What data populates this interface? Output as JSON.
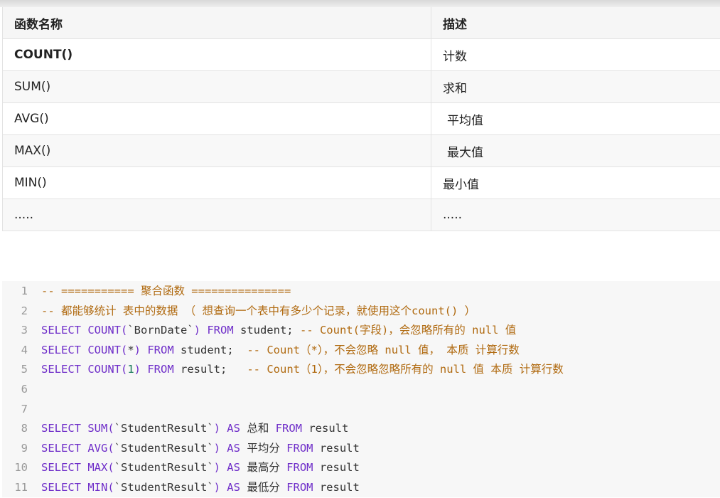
{
  "table": {
    "header": {
      "col1": "函数名称",
      "col2": "描述"
    },
    "rows": [
      {
        "name": "COUNT()",
        "desc": "计数"
      },
      {
        "name": "SUM()",
        "desc": "求和"
      },
      {
        "name": "AVG()",
        "desc": "平均值"
      },
      {
        "name": "MAX()",
        "desc": "最大值"
      },
      {
        "name": "MIN()",
        "desc": "最小值"
      },
      {
        "name": ".....",
        "desc": "....."
      }
    ]
  },
  "code": {
    "lines": [
      {
        "num": "1",
        "t": [
          [
            "cm",
            "-- =========== 聚合函数 ==============="
          ]
        ]
      },
      {
        "num": "2",
        "t": [
          [
            "cm",
            "-- 都能够统计 表中的数据 （ 想查询一个表中有多少个记录，就使用这个count() ）"
          ]
        ]
      },
      {
        "num": "3",
        "t": [
          [
            "kw",
            "SELECT COUNT("
          ],
          [
            "pl",
            "`BornDate`"
          ],
          [
            "kw",
            ") FROM "
          ],
          [
            "pl",
            "student; "
          ],
          [
            "cm",
            "-- Count(字段)，会忽略所有的 null 值"
          ]
        ]
      },
      {
        "num": "4",
        "t": [
          [
            "kw",
            "SELECT COUNT("
          ],
          [
            "pl",
            "*"
          ],
          [
            "kw",
            ") FROM "
          ],
          [
            "pl",
            "student;  "
          ],
          [
            "cm",
            "-- Count（*），不会忽略 null 值， 本质 计算行数"
          ]
        ]
      },
      {
        "num": "5",
        "t": [
          [
            "kw",
            "SELECT COUNT("
          ],
          [
            "nm",
            "1"
          ],
          [
            "kw",
            ") FROM "
          ],
          [
            "pl",
            "result;   "
          ],
          [
            "cm",
            "-- Count（1），不会忽略忽略所有的 null 值 本质 计算行数"
          ]
        ]
      },
      {
        "num": "6",
        "t": []
      },
      {
        "num": "7",
        "t": []
      },
      {
        "num": "8",
        "t": [
          [
            "kw",
            "SELECT SUM("
          ],
          [
            "pl",
            "`StudentResult`"
          ],
          [
            "kw",
            ") AS "
          ],
          [
            "pl",
            "总和 "
          ],
          [
            "kw",
            "FROM "
          ],
          [
            "pl",
            "result"
          ]
        ]
      },
      {
        "num": "9",
        "t": [
          [
            "kw",
            "SELECT AVG("
          ],
          [
            "pl",
            "`StudentResult`"
          ],
          [
            "kw",
            ") AS "
          ],
          [
            "pl",
            "平均分 "
          ],
          [
            "kw",
            "FROM "
          ],
          [
            "pl",
            "result"
          ]
        ]
      },
      {
        "num": "10",
        "t": [
          [
            "kw",
            "SELECT MAX("
          ],
          [
            "pl",
            "`StudentResult`"
          ],
          [
            "kw",
            ") AS "
          ],
          [
            "pl",
            "最高分 "
          ],
          [
            "kw",
            "FROM "
          ],
          [
            "pl",
            "result"
          ]
        ]
      },
      {
        "num": "11",
        "t": [
          [
            "kw",
            "SELECT MIN("
          ],
          [
            "pl",
            "`StudentResult`"
          ],
          [
            "kw",
            ") AS "
          ],
          [
            "pl",
            "最低分 "
          ],
          [
            "kw",
            "FROM "
          ],
          [
            "pl",
            "result"
          ]
        ]
      }
    ]
  }
}
